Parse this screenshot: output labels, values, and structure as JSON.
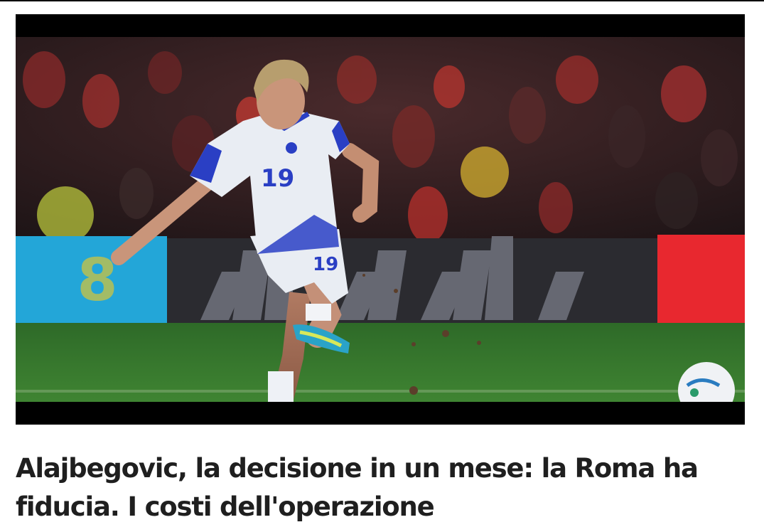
{
  "article": {
    "headline": "Alajbegovic, la decisione in un mese: la Roma ha fiducia. I costi dell'operazione",
    "photo": {
      "player_number": "19",
      "colors": {
        "crowd": "#2a1a1c",
        "pitch": "#2f6e2a",
        "board_left": "#23a6d8",
        "board_right": "#e8282f",
        "board_mid": "#2b2b30",
        "kit": "#e9edf3",
        "kit_trim": "#2a3fc4"
      }
    }
  }
}
